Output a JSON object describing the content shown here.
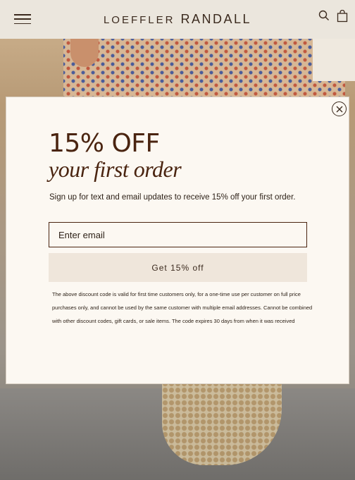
{
  "header": {
    "brand_first": "LOEFFLER",
    "brand_second": "RANDALL",
    "menu_icon": "hamburger-icon",
    "search_icon": "search-icon",
    "bag_icon": "shopping-bag-icon"
  },
  "modal": {
    "close_icon": "close-icon",
    "headline": "15% OFF",
    "subheadline": "your first order",
    "description": "Sign up for text and email updates to receive 15% off your first order.",
    "email_placeholder": "Enter email",
    "email_value": "",
    "submit_label": "Get 15% off",
    "disclaimer": "The above discount code is valid for first time customers only, for a one-time use per customer on full price purchases only, and cannot be used by the same customer with multiple email addresses. Cannot be combined with other discount codes, gift cards, or sale items. The code expires 30 days from when it was received"
  },
  "colors": {
    "accent": "#4a2410",
    "header_bg": "#ebe6dd",
    "modal_bg": "#fcf8f2",
    "button_bg": "#efe6db"
  }
}
